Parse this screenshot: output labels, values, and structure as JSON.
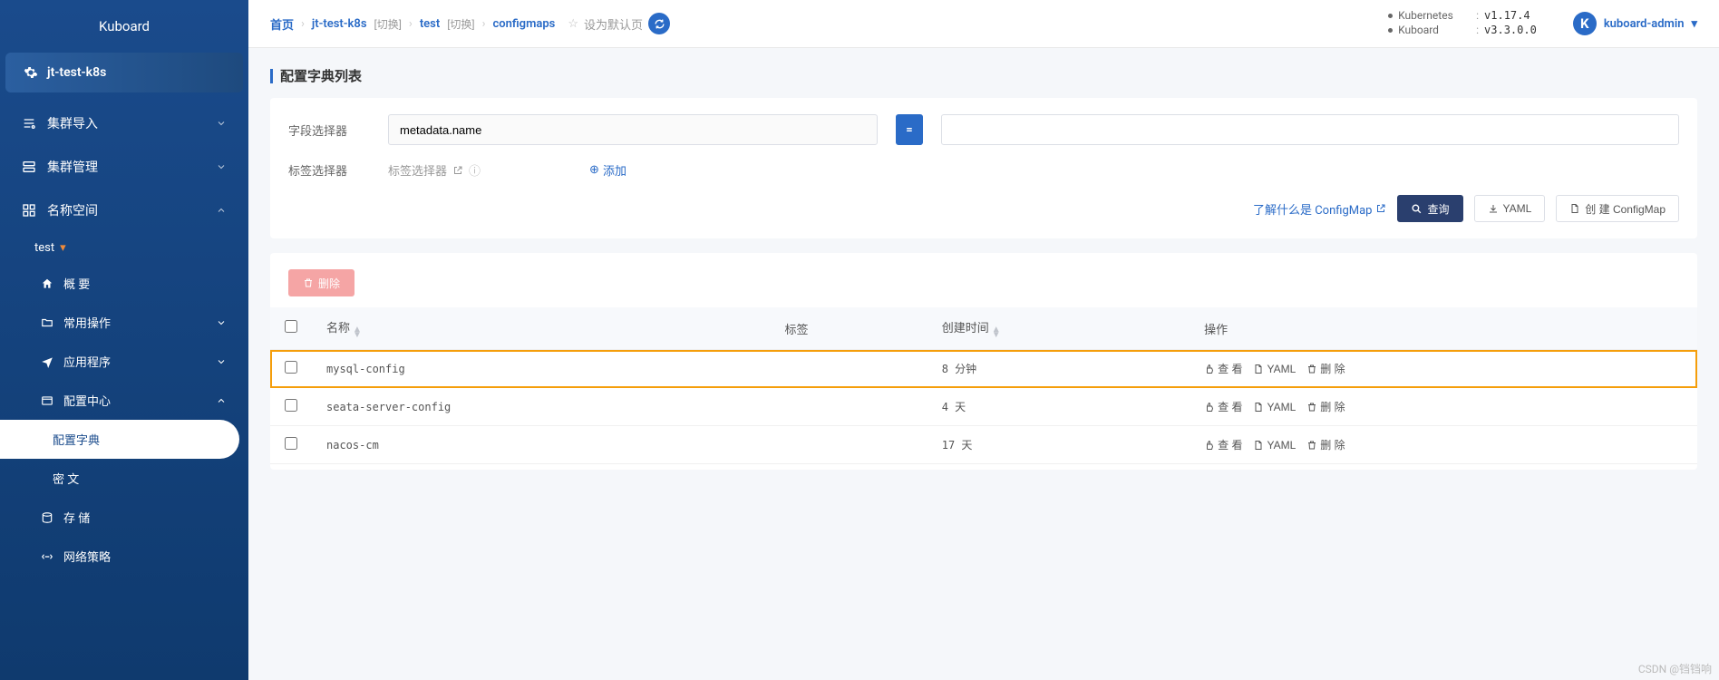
{
  "sidebar": {
    "logo": "Kuboard",
    "cluster": "jt-test-k8s",
    "items": [
      {
        "icon": "import",
        "label": "集群导入",
        "chev": "down"
      },
      {
        "icon": "manage",
        "label": "集群管理",
        "chev": "down"
      },
      {
        "icon": "namespace",
        "label": "名称空间",
        "chev": "up"
      }
    ],
    "ns_selected": "test",
    "ns_children": [
      {
        "icon": "home",
        "label": "概 要"
      },
      {
        "icon": "folder",
        "label": "常用操作",
        "chev": "down"
      },
      {
        "icon": "plane",
        "label": "应用程序",
        "chev": "down"
      },
      {
        "icon": "config",
        "label": "配置中心",
        "chev": "up"
      }
    ],
    "config_children": [
      {
        "label": "配置字典",
        "active": true
      },
      {
        "label": "密 文",
        "active": false
      }
    ],
    "tail": [
      {
        "icon": "storage",
        "label": "存 储"
      },
      {
        "icon": "network",
        "label": "网络策略"
      }
    ]
  },
  "breadcrumb": {
    "home": "首页",
    "cluster": "jt-test-k8s",
    "switch": "[切换]",
    "ns": "test",
    "resource": "configmaps",
    "set_default": "设为默认页"
  },
  "versions": {
    "k8s_label": "Kubernetes",
    "k8s_value": "v1.17.4",
    "kb_label": "Kuboard",
    "kb_value": "v3.3.0.0"
  },
  "user": {
    "name": "kuboard-admin",
    "initial": "K"
  },
  "page": {
    "title": "配置字典列表"
  },
  "filters": {
    "field_label": "字段选择器",
    "field_value": "metadata.name",
    "tag_label": "标签选择器",
    "tag_placeholder": "标签选择器",
    "add_label": "添加"
  },
  "actions": {
    "learn": "了解什么是 ConfigMap",
    "query": "查询",
    "yaml": "YAML",
    "create": "创 建 ConfigMap",
    "delete": "删除"
  },
  "table": {
    "cols": {
      "name": "名称",
      "labels": "标签",
      "created": "创建时间",
      "ops": "操作"
    },
    "row_ops": {
      "view": "查 看",
      "yaml": "YAML",
      "delete": "删 除"
    },
    "rows": [
      {
        "name": "mysql-config",
        "labels": "",
        "created": "8 分钟",
        "highlight": true
      },
      {
        "name": "seata-server-config",
        "labels": "",
        "created": "4 天",
        "highlight": false
      },
      {
        "name": "nacos-cm",
        "labels": "",
        "created": "17 天",
        "highlight": false
      }
    ]
  },
  "watermark": "CSDN @铛铛响"
}
